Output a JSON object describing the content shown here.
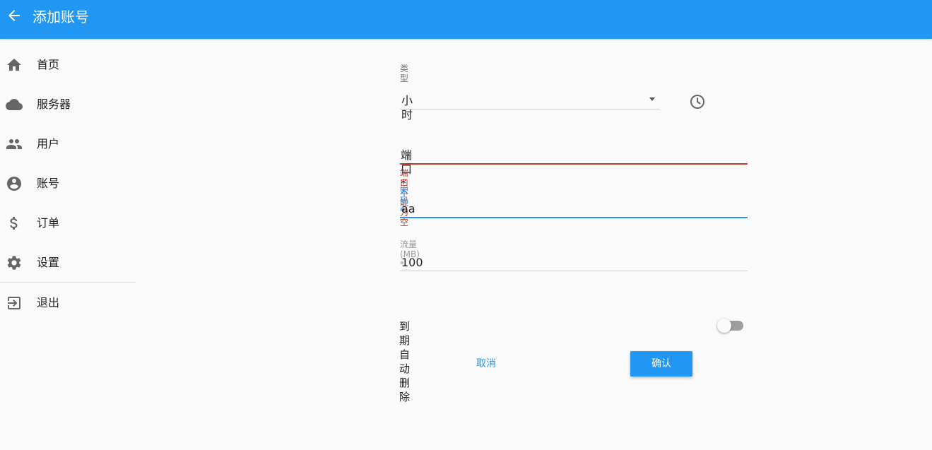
{
  "app": {
    "title": "添加账号",
    "back_icon": "arrow-back-icon"
  },
  "sidebar": {
    "items": [
      {
        "label": "首页",
        "icon": "home-icon"
      },
      {
        "label": "服务器",
        "icon": "cloud-icon"
      },
      {
        "label": "用户",
        "icon": "people-icon"
      },
      {
        "label": "账号",
        "icon": "account-circle-icon"
      },
      {
        "label": "订单",
        "icon": "dollar-icon"
      },
      {
        "label": "设置",
        "icon": "gear-icon"
      },
      {
        "label": "退出",
        "icon": "exit-icon"
      }
    ]
  },
  "form": {
    "type": {
      "label": "类型",
      "value": "小时",
      "icon": "clock-icon"
    },
    "port": {
      "label": "端口 *",
      "value": "",
      "error": "端口不能为空"
    },
    "password": {
      "label": "密码 *",
      "value": "aa"
    },
    "traffic": {
      "label": "流量(MB) *",
      "value": "100"
    },
    "auto_delete": {
      "label": "到期自动删除",
      "enabled": false
    },
    "cancel_label": "取消",
    "confirm_label": "确认"
  },
  "colors": {
    "primary": "#2196f3",
    "error": "#c0392b",
    "background": "#fafafa"
  }
}
